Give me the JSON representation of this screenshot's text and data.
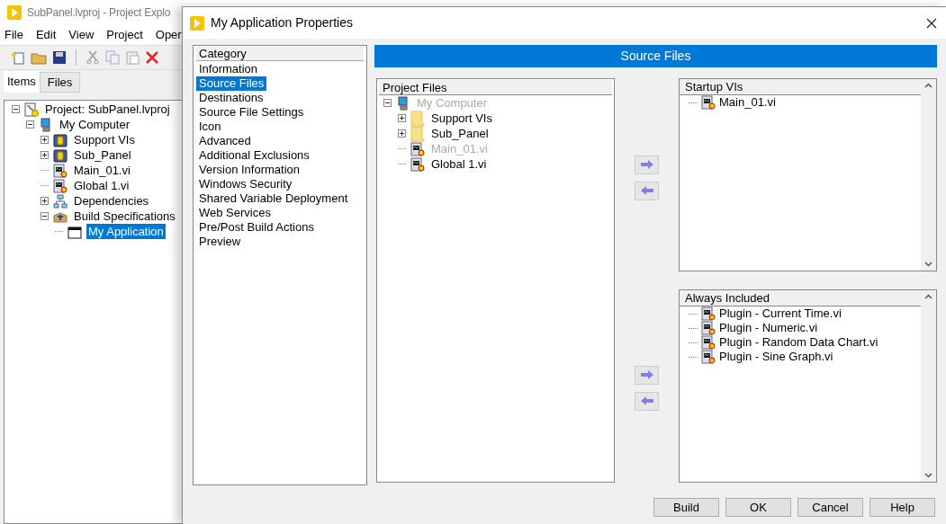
{
  "explorer": {
    "title": "SubPanel.lvproj - Project Explo",
    "menu": [
      "File",
      "Edit",
      "View",
      "Project",
      "Oper"
    ],
    "tabs": [
      {
        "label": "Items",
        "selected": true
      },
      {
        "label": "Files",
        "selected": false
      }
    ],
    "tree": [
      {
        "label": "Project: SubPanel.lvproj",
        "kind": "project",
        "expanded": true,
        "selected": false,
        "children": [
          {
            "label": "My Computer",
            "kind": "computer",
            "expanded": true,
            "selected": false,
            "children": [
              {
                "label": "Support VIs",
                "kind": "library",
                "expanded": false,
                "selected": false
              },
              {
                "label": "Sub_Panel",
                "kind": "library",
                "expanded": false,
                "selected": false
              },
              {
                "label": "Main_01.vi",
                "kind": "vi",
                "selected": false
              },
              {
                "label": "Global 1.vi",
                "kind": "vi",
                "selected": false
              },
              {
                "label": "Dependencies",
                "kind": "dependencies",
                "expanded": false,
                "selected": false
              },
              {
                "label": "Build Specifications",
                "kind": "build",
                "expanded": true,
                "selected": false,
                "children": [
                  {
                    "label": "My Application",
                    "kind": "app",
                    "selected": true
                  }
                ]
              }
            ]
          }
        ]
      }
    ]
  },
  "dialog": {
    "title": "My Application Properties",
    "category": {
      "heading": "Category",
      "items": [
        {
          "label": "Information",
          "selected": false
        },
        {
          "label": "Source Files",
          "selected": true
        },
        {
          "label": "Destinations",
          "selected": false
        },
        {
          "label": "Source File Settings",
          "selected": false
        },
        {
          "label": "Icon",
          "selected": false
        },
        {
          "label": "Advanced",
          "selected": false
        },
        {
          "label": "Additional Exclusions",
          "selected": false
        },
        {
          "label": "Version Information",
          "selected": false
        },
        {
          "label": "Windows Security",
          "selected": false
        },
        {
          "label": "Shared Variable Deployment",
          "selected": false
        },
        {
          "label": "Web Services",
          "selected": false
        },
        {
          "label": "Pre/Post Build Actions",
          "selected": false
        },
        {
          "label": "Preview",
          "selected": false
        }
      ]
    },
    "page_title": "Source Files",
    "project_files": {
      "heading": "Project Files",
      "tree": [
        {
          "label": "My Computer",
          "kind": "computer",
          "expanded": true,
          "disabled": true,
          "children": [
            {
              "label": "Support VIs",
              "kind": "folder",
              "expanded": false,
              "disabled": false
            },
            {
              "label": "Sub_Panel",
              "kind": "folder",
              "expanded": false,
              "disabled": false
            },
            {
              "label": "Main_01.vi",
              "kind": "vi",
              "disabled": true
            },
            {
              "label": "Global 1.vi",
              "kind": "vi",
              "disabled": false
            }
          ]
        }
      ]
    },
    "startup_vis": {
      "heading": "Startup VIs",
      "items": [
        "Main_01.vi"
      ]
    },
    "always_included": {
      "heading": "Always Included",
      "items": [
        "Plugin - Current Time.vi",
        "Plugin - Numeric.vi",
        "Plugin - Random Data Chart.vi",
        "Plugin - Sine Graph.vi"
      ]
    },
    "buttons": [
      "Build",
      "OK",
      "Cancel",
      "Help"
    ]
  }
}
